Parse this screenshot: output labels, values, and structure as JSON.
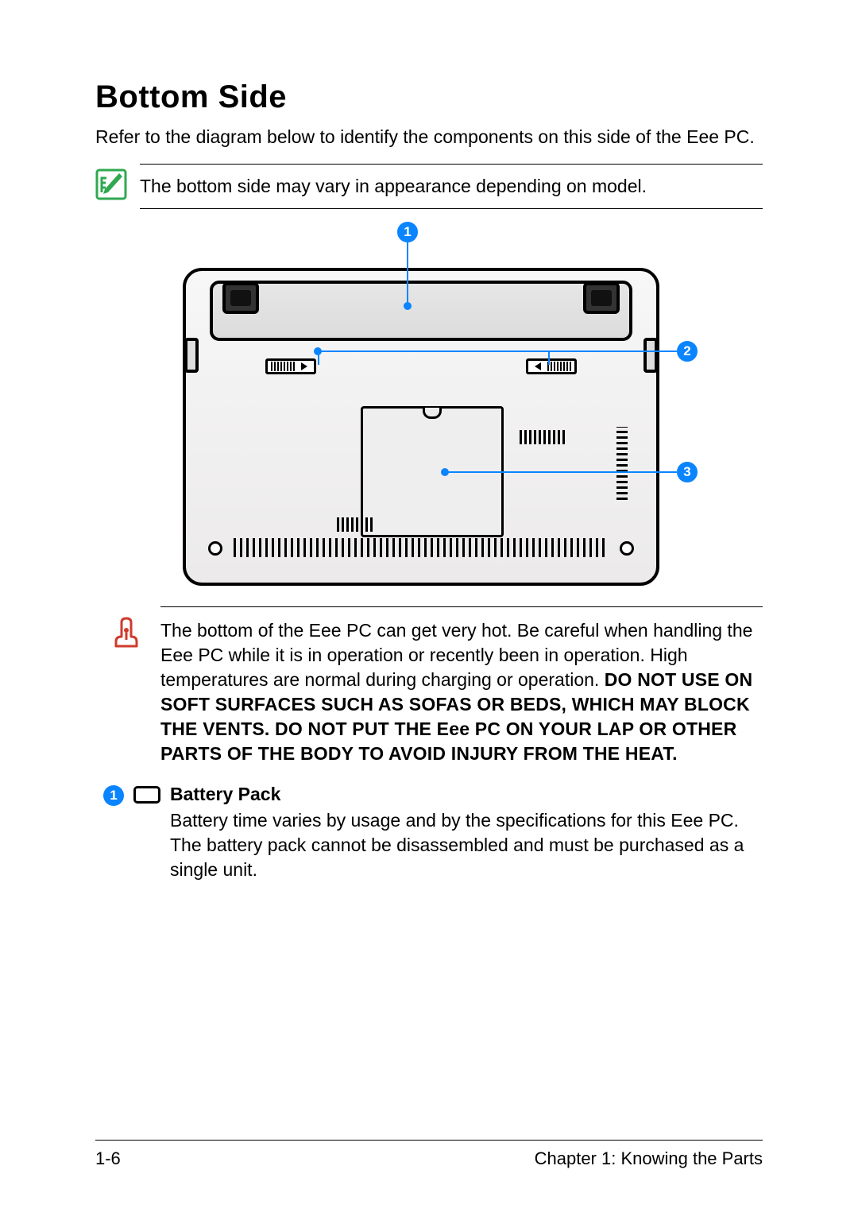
{
  "heading": "Bottom Side",
  "intro": "Refer to the diagram below to identify the components on this side of the Eee PC.",
  "note": {
    "text": "The bottom side may vary in appearance depending on model."
  },
  "callouts": {
    "c1": "1",
    "c2": "2",
    "c3": "3"
  },
  "warning": {
    "lead": "The bottom of the Eee PC can get very hot. Be careful when handling the Eee PC while it is in operation or recently been in operation. High temperatures are normal during charging or operation. ",
    "bold": "DO NOT USE ON SOFT SURFACES SUCH AS SOFAS OR BEDS, WHICH MAY BLOCK THE VENTS. DO NOT PUT THE Eee PC ON YOUR LAP OR OTHER PARTS OF THE BODY TO AVOID INJURY FROM THE HEAT."
  },
  "item1": {
    "badge": "1",
    "title": "Battery Pack",
    "text": "Battery time varies by usage and by the specifications for this Eee PC. The battery pack cannot be disassembled and must be purchased as a single unit."
  },
  "footer": {
    "page": "1-6",
    "chapter": "Chapter 1: Knowing the Parts"
  }
}
